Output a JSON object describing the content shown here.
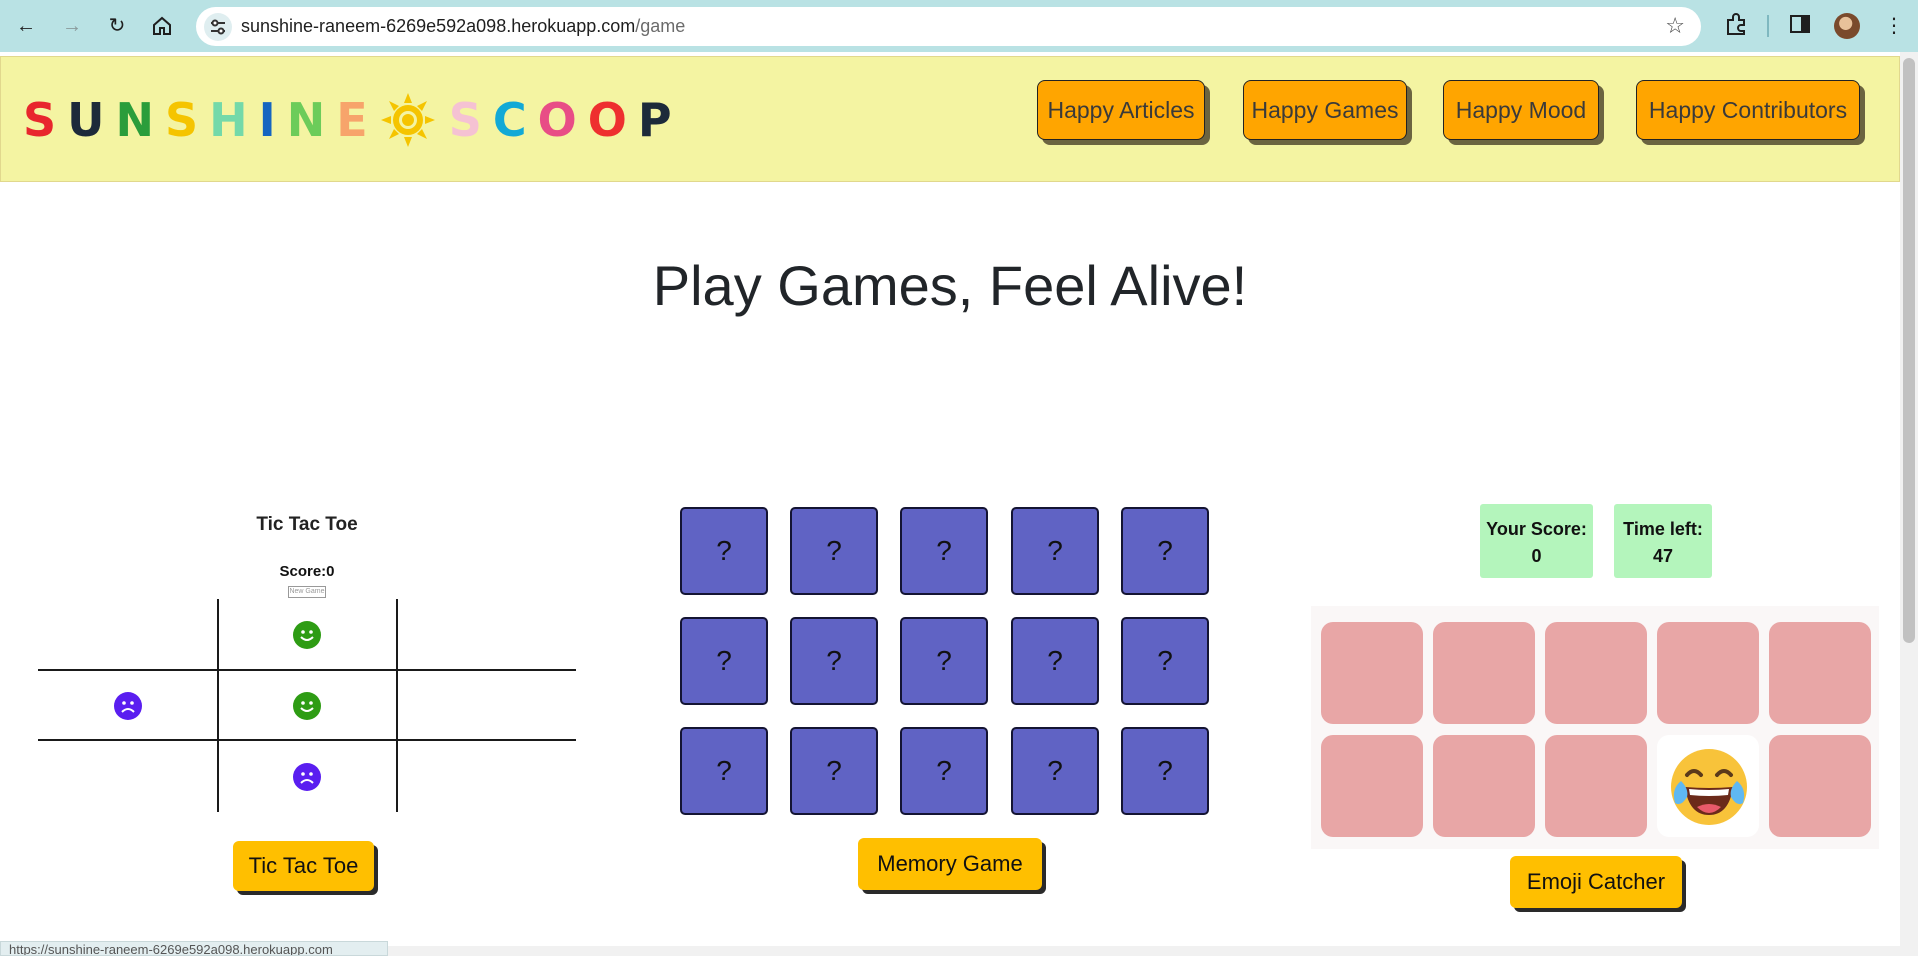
{
  "browser": {
    "url_host": "sunshine-raneem-6269e592a098.herokuapp.com",
    "url_path": "/game",
    "status_text": "https://sunshine-raneem-6269e592a098.herokuapp.com"
  },
  "logo": {
    "letters_left": [
      "S",
      "U",
      "N",
      "S",
      "H",
      "I",
      "N",
      "E"
    ],
    "letters_right": [
      "S",
      "C",
      "O",
      "O",
      "P"
    ],
    "colors_left": [
      "#e8262d",
      "#1d2a3a",
      "#2a9d3b",
      "#f5c400",
      "#74d9a9",
      "#1565c0",
      "#6ccc5a",
      "#f7a46b"
    ],
    "colors_right": [
      "#f5c2d3",
      "#12a9d6",
      "#e84d86",
      "#ee2f2f",
      "#1d2a3a"
    ],
    "sun_color": "#f5c400"
  },
  "nav": {
    "items": [
      "Happy Articles",
      "Happy Games",
      "Happy Mood",
      "Happy Contributors"
    ]
  },
  "hero": {
    "title": "Play Games, Feel Alive!"
  },
  "tictactoe": {
    "title": "Tic Tac Toe",
    "score_label": "Score:",
    "score_value": "0",
    "new_game_label": "New Game",
    "button_label": "Tic Tac Toe",
    "cells": [
      [
        "",
        "happy",
        ""
      ],
      [
        "sad",
        "happy",
        ""
      ],
      [
        "",
        "sad",
        ""
      ]
    ]
  },
  "memory": {
    "card_symbol": "?",
    "rows": 3,
    "cols": 5,
    "button_label": "Memory Game"
  },
  "emoji_catcher": {
    "score_label": "Your Score:",
    "score_value": "0",
    "time_label": "Time left:",
    "time_value": "47",
    "active_emoji": "😂",
    "button_label": "Emoji Catcher"
  }
}
